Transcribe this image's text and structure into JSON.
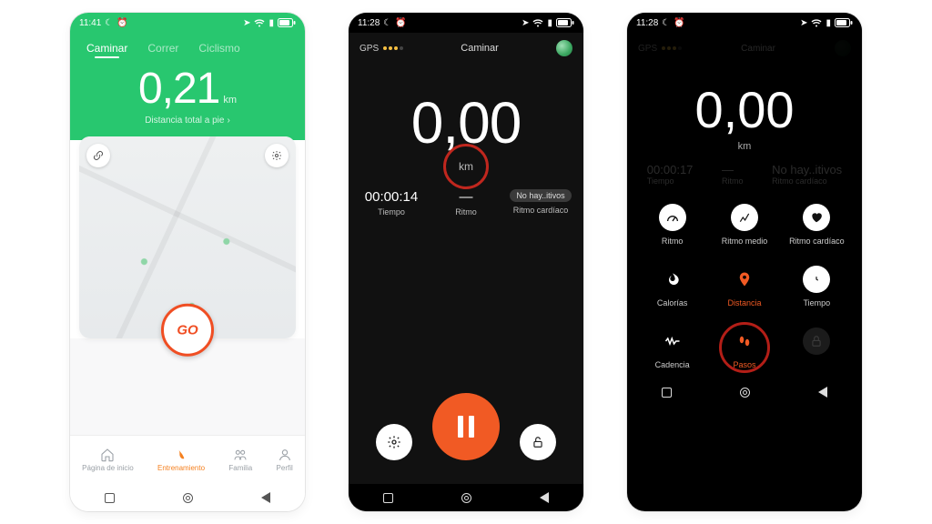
{
  "phone1": {
    "status": {
      "time": "11:41",
      "icons": [
        "moon",
        "alarm",
        "location",
        "wifi",
        "signal",
        "battery"
      ]
    },
    "tabs": [
      {
        "label": "Caminar",
        "active": true
      },
      {
        "label": "Correr",
        "active": false
      },
      {
        "label": "Ciclismo",
        "active": false
      }
    ],
    "distance_value": "0,21",
    "distance_unit": "km",
    "subtitle": "Distancia total a pie",
    "go_label": "GO",
    "bottom_nav": [
      {
        "label": "Página de inicio",
        "active": false
      },
      {
        "label": "Entrenamiento",
        "active": true
      },
      {
        "label": "Familia",
        "active": false
      },
      {
        "label": "Perfil",
        "active": false
      }
    ]
  },
  "phone2": {
    "status": {
      "time": "11:28",
      "icons": [
        "moon",
        "alarm",
        "location",
        "wifi",
        "signal",
        "battery"
      ]
    },
    "gps_label": "GPS",
    "activity": "Caminar",
    "distance_value": "0,00",
    "distance_unit": "km",
    "stats": {
      "time": {
        "value": "00:00:14",
        "label": "Tiempo"
      },
      "pace": {
        "value": "—",
        "label": "Ritmo"
      },
      "hr": {
        "value": "No hay..itivos",
        "label": "Ritmo cardíaco"
      }
    }
  },
  "phone3": {
    "status": {
      "time": "11:28",
      "icons": [
        "moon",
        "alarm",
        "location",
        "wifi",
        "signal",
        "battery"
      ]
    },
    "distance_value": "0,00",
    "distance_unit": "km",
    "faint_stats": {
      "time": {
        "value": "00:00:17",
        "label": "Tiempo"
      },
      "pace": {
        "value": "—",
        "label": "Ritmo"
      },
      "hr": {
        "value": "No hay..itivos",
        "label": "Ritmo cardíaco"
      }
    },
    "grid": [
      {
        "key": "ritmo",
        "label": "Ritmo",
        "icon": "gauge"
      },
      {
        "key": "ritmo_medio",
        "label": "Ritmo medio",
        "icon": "chart"
      },
      {
        "key": "ritmo_card",
        "label": "Ritmo cardíaco",
        "icon": "heart"
      },
      {
        "key": "calorias",
        "label": "Calorías",
        "icon": "flame"
      },
      {
        "key": "distancia",
        "label": "Distancia",
        "icon": "pin"
      },
      {
        "key": "tiempo",
        "label": "Tiempo",
        "icon": "clock"
      },
      {
        "key": "cadencia",
        "label": "Cadencia",
        "icon": "wave"
      },
      {
        "key": "pasos",
        "label": "Pasos",
        "icon": "feet"
      },
      {
        "key": "lock",
        "label": "",
        "icon": "lock"
      }
    ]
  }
}
